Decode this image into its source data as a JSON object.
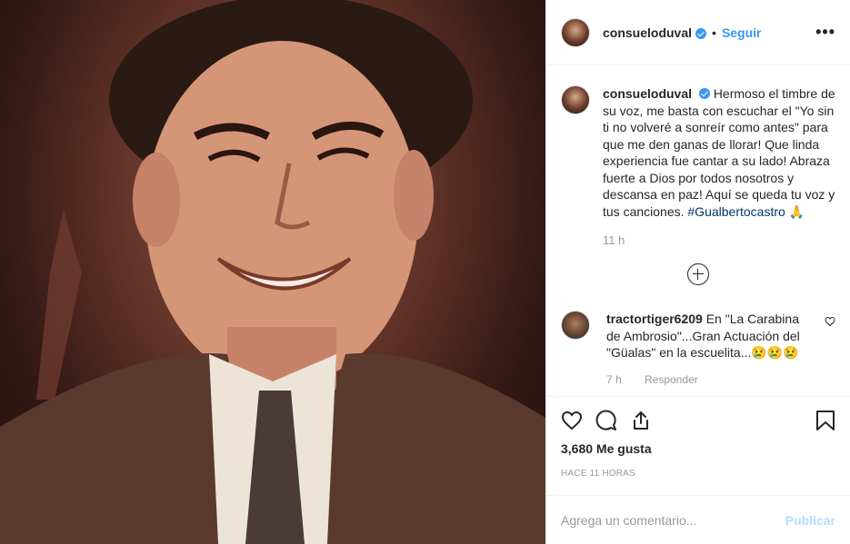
{
  "post": {
    "username": "consueloduval",
    "follow_label": "Seguir",
    "dot": "•",
    "more_label": "•••"
  },
  "caption": {
    "username": "consueloduval",
    "text": "Hermoso el timbre de su voz, me basta con escuchar el \"Yo sin ti no volveré a sonreír como antes\" para que me den ganas de llorar! Que linda experiencia fue cantar a su lado! Abraza fuerte a Dios por todos nosotros y descansa en paz! Aquí se queda tu voz y tus canciones.",
    "hashtag": "#Gualbertocastro",
    "emoji": "🙏",
    "time": "11 h"
  },
  "comment": {
    "username": "tractortiger6209",
    "text": "En \"La Carabina de Ambrosio\"...Gran Actuación del \"Güalas\" en la escuelita...😢😢😢",
    "time": "7 h",
    "reply_label": "Responder"
  },
  "stats": {
    "likes": "3,680 Me gusta",
    "ago": "HACE 11 HORAS"
  },
  "add_comment": {
    "placeholder": "Agrega un comentario...",
    "publish_label": "Publicar"
  },
  "colors": {
    "accent": "#3897f0",
    "hashtag": "#003569",
    "muted": "#999999",
    "publish_disabled": "#b3dbff"
  }
}
